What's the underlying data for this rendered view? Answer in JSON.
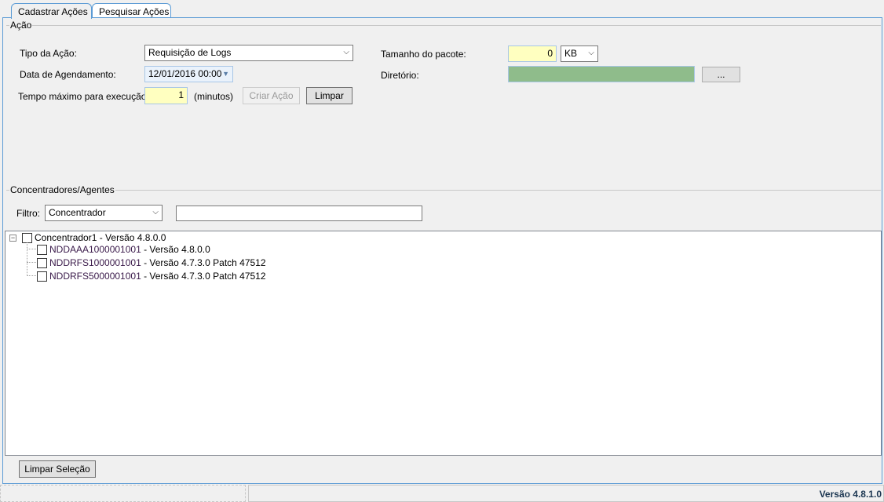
{
  "tabs": [
    {
      "label": "Cadastrar Ações",
      "active": true
    },
    {
      "label": "Pesquisar Ações",
      "active": false
    }
  ],
  "acao": {
    "group_title": "Ação",
    "tipo_label": "Tipo da Ação:",
    "tipo_value": "Requisição de Logs",
    "data_label": "Data de Agendamento:",
    "data_value": "12/01/2016 00:00",
    "tempo_label": "Tempo máximo para execução:",
    "tempo_value": "1",
    "tempo_unit": "(minutos)",
    "criar_button": "Criar Ação",
    "limpar_button": "Limpar",
    "tamanho_label": "Tamanho do pacote:",
    "tamanho_value": "0",
    "tamanho_unit": "KB",
    "diretorio_label": "Diretório:",
    "diretorio_value": "",
    "browse_button": "...",
    "colors": {
      "yellow_input": "#ffffc0",
      "green_dir": "#8fbc8b"
    }
  },
  "agentes": {
    "group_title": "Concentradores/Agentes",
    "filtro_label": "Filtro:",
    "filtro_value": "Concentrador",
    "filtro_text": "",
    "tree": {
      "root": {
        "name": "Concentrador1",
        "version": " - Versão 4.8.0.0"
      },
      "children": [
        {
          "name": "NDDAAA1000001001",
          "version": " - Versão 4.8.0.0"
        },
        {
          "name": "NDDRFS1000001001",
          "version": " - Versão 4.7.3.0 Patch 47512"
        },
        {
          "name": "NDDRFS5000001001",
          "version": " - Versão 4.7.3.0 Patch 47512"
        }
      ]
    },
    "limpar_selecao_button": "Limpar Seleção"
  },
  "status": {
    "version": "Versão 4.8.1.0"
  }
}
